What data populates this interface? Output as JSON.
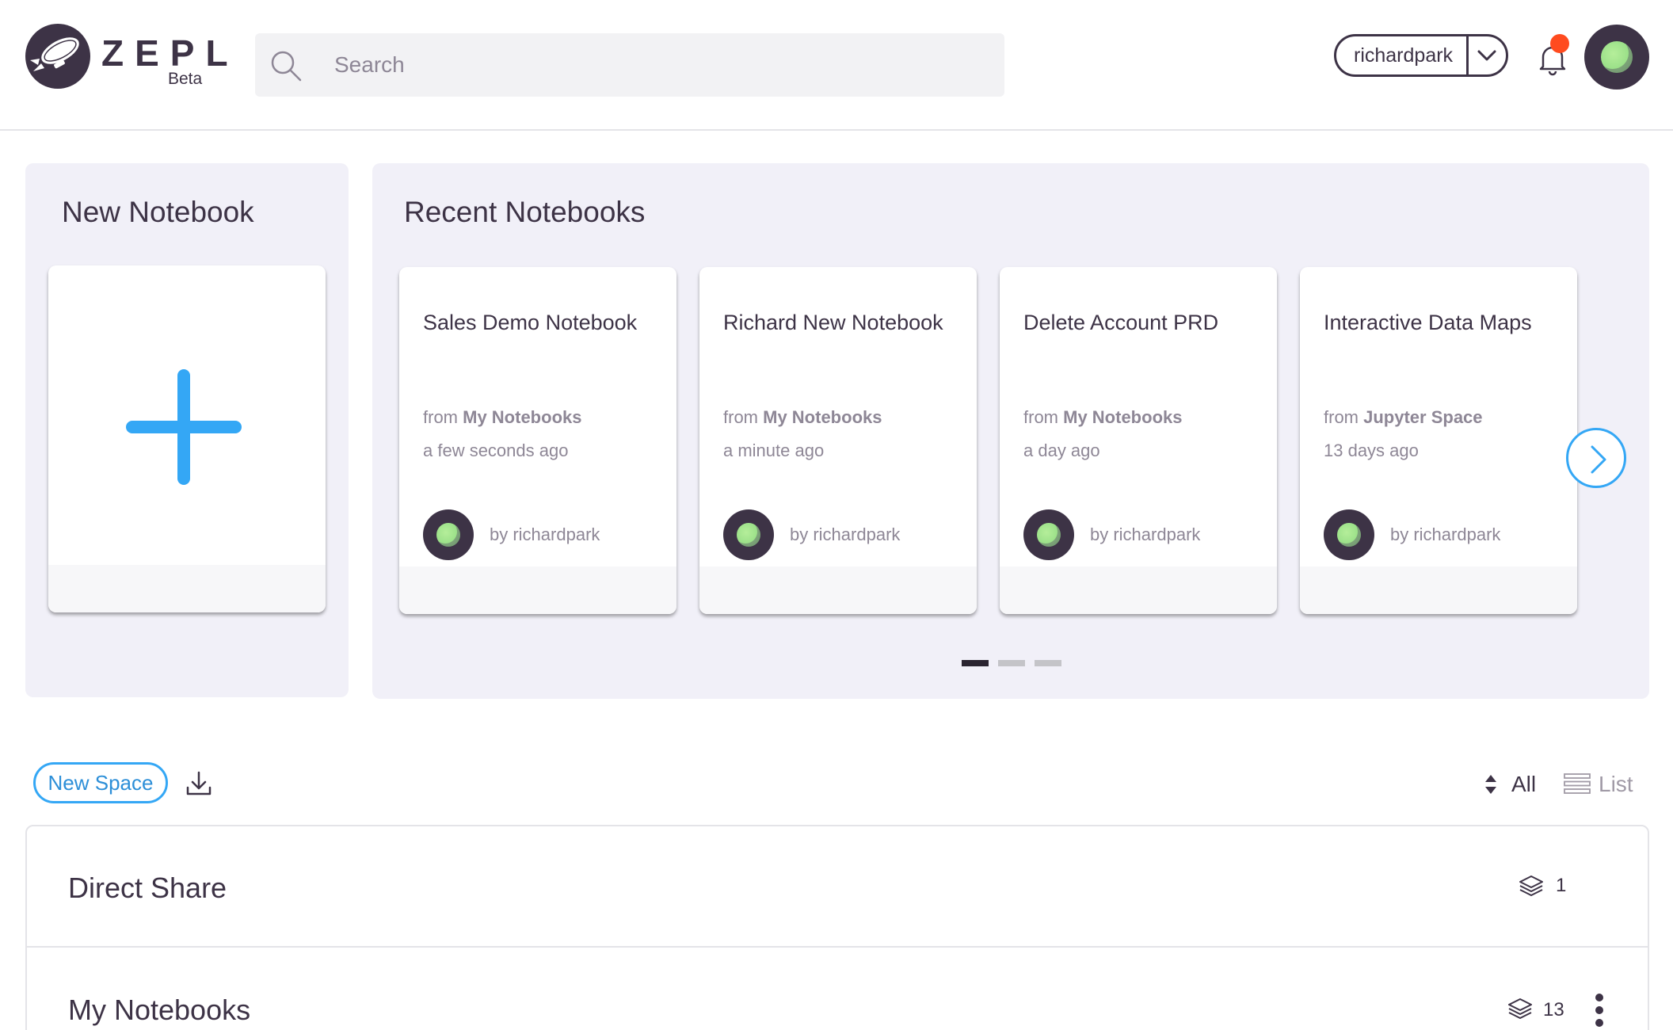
{
  "header": {
    "logo_text": "ZEPL",
    "logo_badge": "Beta",
    "search_placeholder": "Search",
    "user_select_value": "richardpark",
    "notification_dot_color": "#ff4b1f"
  },
  "new_notebook": {
    "title": "New Notebook"
  },
  "recent_notebooks": {
    "title": "Recent Notebooks",
    "from_prefix": "from",
    "cards": [
      {
        "title": "Sales Demo Notebook",
        "source": "My Notebooks",
        "time": "a few seconds ago",
        "author": "by richardpark"
      },
      {
        "title": "Richard New Notebook",
        "source": "My Notebooks",
        "time": "a minute ago",
        "author": "by richardpark"
      },
      {
        "title": "Delete Account PRD",
        "source": "My Notebooks",
        "time": "a day ago",
        "author": "by richardpark"
      },
      {
        "title": "Interactive Data Maps",
        "source": "Jupyter Space",
        "time": "13 days ago",
        "author": "by richardpark"
      }
    ],
    "page_count": 3,
    "current_page": 1
  },
  "spaces_toolbar": {
    "new_space_label": "New Space",
    "sort_label": "All",
    "view_label": "List"
  },
  "spaces": [
    {
      "name": "Direct Share",
      "count": "1"
    },
    {
      "name": "My Notebooks",
      "count": "13"
    }
  ],
  "colors": {
    "brand_dark": "#3d3346",
    "accent_blue": "#34a7f5",
    "panel_bg": "#f1f0f8",
    "muted_text": "#8e8796"
  }
}
